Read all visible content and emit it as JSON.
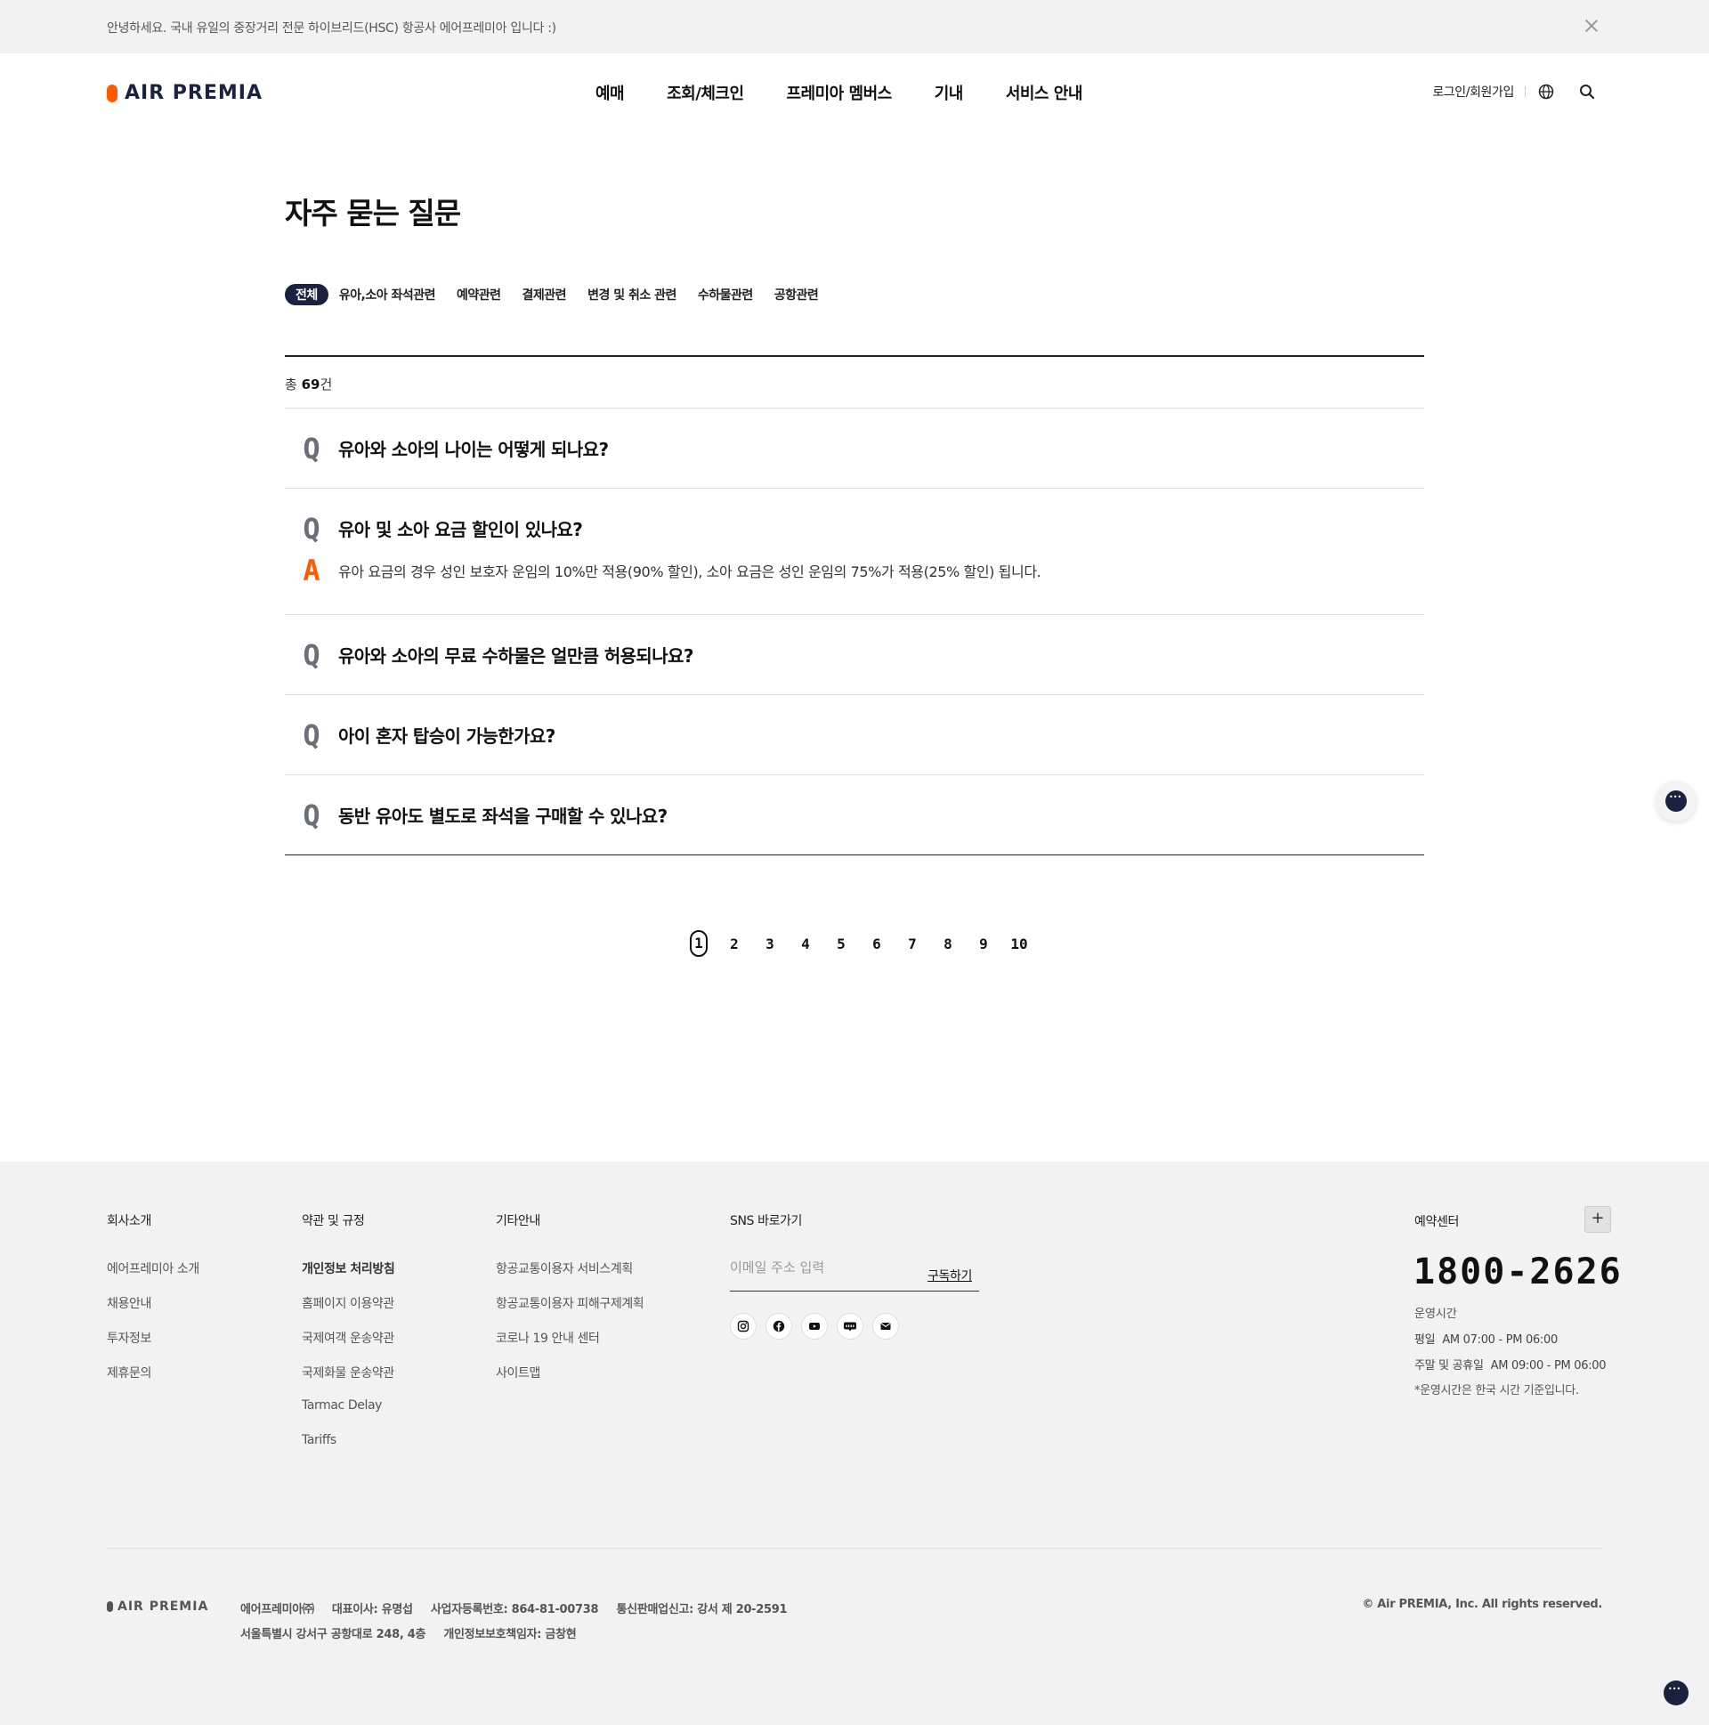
{
  "notice": {
    "text": "안녕하세요. 국내 유일의 중장거리 전문 하이브리드(HSC) 항공사 에어프레미아 입니다 :)",
    "close_icon": "close-icon"
  },
  "header": {
    "logo_text": "AIR PREMIA",
    "brand_color": "#ff5a00",
    "nav": [
      "예매",
      "조회/체크인",
      "프레미아 멤버스",
      "기내",
      "서비스 안내"
    ],
    "login_label": "로그인/회원가입",
    "icons": [
      "globe-icon",
      "search-icon"
    ]
  },
  "page": {
    "title": "자주 묻는 질문",
    "tabs": [
      "전체",
      "유아,소아 좌석관련",
      "예약관련",
      "결제관련",
      "변경 및 취소 관련",
      "수하물관련",
      "공항관련"
    ],
    "active_tab": "전체",
    "count_prefix": "총 ",
    "count_value": "69",
    "count_suffix": "건"
  },
  "faq": {
    "q_mark": "Q",
    "a_mark": "A",
    "items": [
      {
        "q": "유아와 소아의 나이는 어떻게 되나요?"
      },
      {
        "q": "유아 및 소아 요금 할인이 있나요?",
        "a": "유아 요금의 경우 성인 보호자 운임의 10%만 적용(90% 할인), 소아 요금은 성인 운임의 75%가 적용(25% 할인) 됩니다."
      },
      {
        "q": "유아와 소아의 무료 수하물은 얼만큼 허용되나요?"
      },
      {
        "q": "아이 혼자 탑승이 가능한가요?"
      },
      {
        "q": "동반 유아도 별도로 좌석을 구매할 수 있나요?"
      }
    ]
  },
  "pagination": {
    "pages": [
      "1",
      "2",
      "3",
      "4",
      "5",
      "6",
      "7",
      "8",
      "9",
      "10"
    ],
    "current": "1"
  },
  "footer": {
    "col1": {
      "title": "회사소개",
      "links": [
        "에어프레미아 소개",
        "채용안내",
        "투자정보",
        "제휴문의"
      ]
    },
    "col2": {
      "title": "약관 및 규정",
      "links": [
        "개인정보 처리방침",
        "홈페이지 이용약관",
        "국제여객 운송약관",
        "국제화물 운송약관",
        "Tarmac Delay",
        "Tariffs"
      ]
    },
    "col3": {
      "title": "기타안내",
      "links": [
        "항공교통이용자 서비스계획",
        "항공교통이용자 피해구제계획",
        "코로나 19 안내 센터",
        "사이트맵"
      ]
    },
    "sns": {
      "title": "SNS 바로가기",
      "email_placeholder": "이메일 주소 입력",
      "subscribe_label": "구독하기",
      "icons": [
        "instagram-icon",
        "facebook-icon",
        "youtube-icon",
        "blog-icon",
        "mail-icon"
      ]
    },
    "call": {
      "title": "예약센터",
      "toggle": "+",
      "phone": "1800-2626",
      "hours_title": "운영시간",
      "weekday_label": "평일",
      "weekday_hours": "AM 07:00 - PM 06:00",
      "weekend_label": "주말 및 공휴일",
      "weekend_hours": "AM 09:00 - PM 06:00",
      "note": "*운영시간은 한국 시간 기준입니다."
    },
    "bottom": {
      "logo_text": "AIR PREMIA",
      "company": "에어프레미아㈜",
      "ceo": "대표이사: 유명섭",
      "biz_no": "사업자등록번호: 864-81-00738",
      "sales_no": "통신판매업신고: 강서 제 20-2591",
      "address": "서울특별시 강서구 공항대로 248, 4층",
      "privacy_officer": "개인정보보호책임자: 금창현",
      "copyright": "© Air PREMIA, Inc. All rights reserved."
    }
  }
}
